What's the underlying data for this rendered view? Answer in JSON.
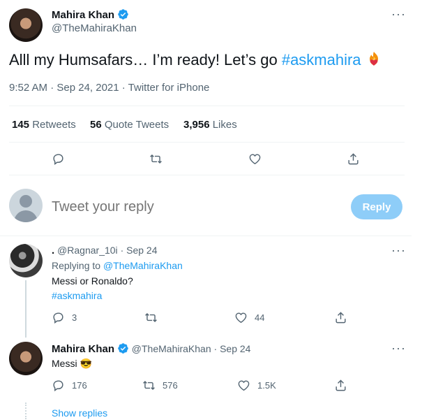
{
  "tweet": {
    "author_name": "Mahira Khan",
    "author_handle": "@TheMahiraKhan",
    "text_prefix": "Alll my Humsafars… I’m ready! Let’s go ",
    "hashtag": "#askmahira",
    "meta": "9:52 AM · Sep 24, 2021 · Twitter for iPhone",
    "stats": {
      "retweets_num": "145",
      "retweets_label": "Retweets",
      "quotes_num": "56",
      "quotes_label": "Quote Tweets",
      "likes_num": "3,956",
      "likes_label": "Likes"
    }
  },
  "composer": {
    "placeholder": "Tweet your reply",
    "button_label": "Reply"
  },
  "replies": [
    {
      "name": ".",
      "handle": "@Ragnar_10i",
      "date": "· Sep 24",
      "replying_to_label": "Replying to",
      "replying_to_handle": "@TheMahiraKhan",
      "text": "Messi or Ronaldo?",
      "hashtag": "#askmahira",
      "counts": {
        "replies": "3",
        "likes": "44"
      }
    },
    {
      "name": "Mahira Khan",
      "handle": "@TheMahiraKhan",
      "date": "· Sep 24",
      "text": "Messi",
      "emoji": "😎",
      "counts": {
        "replies": "176",
        "retweets": "576",
        "likes": "1.5K"
      }
    }
  ],
  "show_replies": "Show replies",
  "colors": {
    "accent": "#1d9bf0",
    "reply_button": "#8ecdf8",
    "muted": "#536471"
  },
  "icons": [
    "verified-badge",
    "more-icon",
    "reply-icon",
    "retweet-icon",
    "like-icon",
    "share-icon",
    "fire-heart-emoji",
    "sunglasses-emoji"
  ]
}
